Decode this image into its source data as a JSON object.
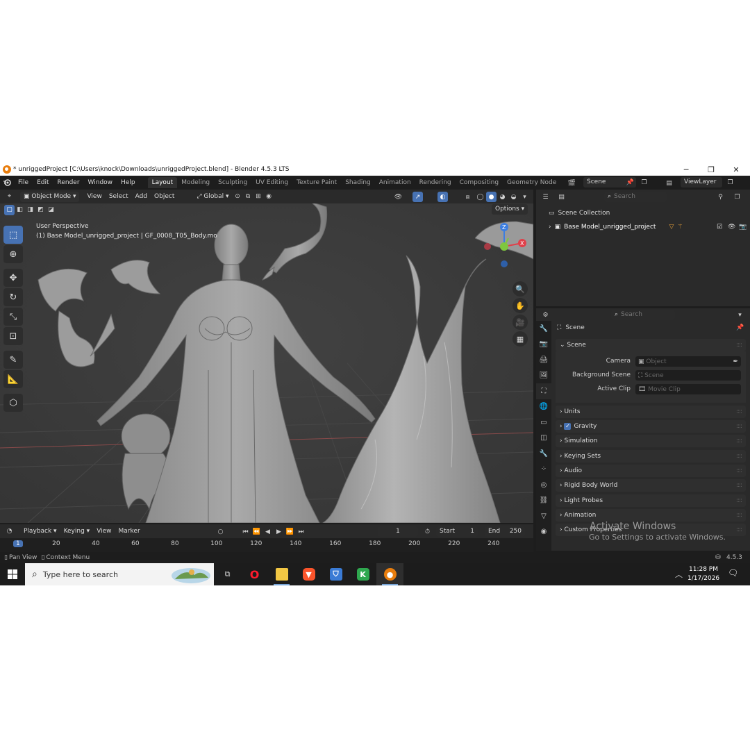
{
  "window": {
    "title": "* unriggedProject [C:\\Users\\knock\\Downloads\\unriggedProject.blend] - Blender 4.5.3 LTS",
    "minimize_glyph": "─",
    "restore_glyph": "❐",
    "close_glyph": "✕"
  },
  "menu": [
    "File",
    "Edit",
    "Render",
    "Window",
    "Help"
  ],
  "workspaces": [
    "Layout",
    "Modeling",
    "Sculpting",
    "UV Editing",
    "Texture Paint",
    "Shading",
    "Animation",
    "Rendering",
    "Compositing",
    "Geometry Node"
  ],
  "scene_selector": {
    "value": "Scene"
  },
  "viewlayer_selector": {
    "value": "ViewLayer"
  },
  "viewport": {
    "mode": "Object Mode",
    "header_menu": [
      "View",
      "Select",
      "Add",
      "Object"
    ],
    "transform_orientation": "Global",
    "options_label": "Options",
    "view_name": "User Perspective",
    "object_info": "(1) Base Model_unrigged_project | GF_0008_T05_Body.mo"
  },
  "timeline": {
    "menu": [
      "Playback",
      "Keying",
      "View",
      "Marker"
    ],
    "current_frame": "1",
    "start_label": "Start",
    "start_value": "1",
    "end_label": "End",
    "end_value": "250",
    "ticks": [
      "1",
      "20",
      "40",
      "60",
      "80",
      "100",
      "120",
      "140",
      "160",
      "180",
      "200",
      "220",
      "240"
    ]
  },
  "statusbar": {
    "pan_view": "Pan View",
    "context_menu": "Context Menu",
    "version": "4.5.3"
  },
  "outliner": {
    "search_placeholder": "Search",
    "root": "Scene Collection",
    "items": [
      {
        "label": "Base Model_unrigged_project"
      }
    ]
  },
  "properties": {
    "search_placeholder": "Search",
    "context": "Scene",
    "section_title": "Scene",
    "fields": [
      {
        "label": "Camera",
        "placeholder": "Object"
      },
      {
        "label": "Background Scene",
        "placeholder": "Scene"
      },
      {
        "label": "Active Clip",
        "placeholder": "Movie Clip"
      }
    ],
    "panels": [
      "Units",
      "Gravity",
      "Simulation",
      "Keying Sets",
      "Audio",
      "Rigid Body World",
      "Light Probes",
      "Animation",
      "Custom Properties"
    ],
    "gravity_checked": true
  },
  "watermark": {
    "title": "Activate Windows",
    "subtitle": "Go to Settings to activate Windows."
  },
  "taskbar": {
    "search_placeholder": "Type here to search",
    "time": "11:28 PM",
    "date": "1/17/2026"
  },
  "colors": {
    "accent_blue": "#4772b3",
    "blender_orange": "#e87d0d",
    "axis_x": "#e0404a",
    "axis_y": "#7ec73f",
    "axis_z": "#3d7ee0"
  }
}
